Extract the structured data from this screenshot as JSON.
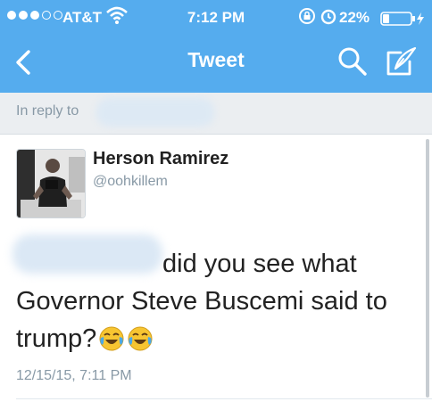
{
  "status_bar": {
    "carrier": "AT&T",
    "time": "7:12 PM",
    "battery_percent": "22%",
    "signal_bars_filled": 3,
    "signal_bars_total": 5
  },
  "nav": {
    "title": "Tweet",
    "back_icon": "chevron-left-icon",
    "search_icon": "search-icon",
    "compose_icon": "compose-icon"
  },
  "reply": {
    "label": "In reply to"
  },
  "tweet": {
    "name": "Herson Ramirez",
    "handle": "@oohkillem",
    "text_line1": "did you see what",
    "text_line2": "Governor Steve Buscemi said to",
    "text_line3": "trump?",
    "emoji": "face-with-tears-of-joy",
    "timestamp": "12/15/15, 7:11 PM"
  },
  "colors": {
    "brand": "#55acee",
    "reply_bg": "#ebeef1",
    "meta_text": "#8899a6",
    "body_text": "#222222"
  }
}
